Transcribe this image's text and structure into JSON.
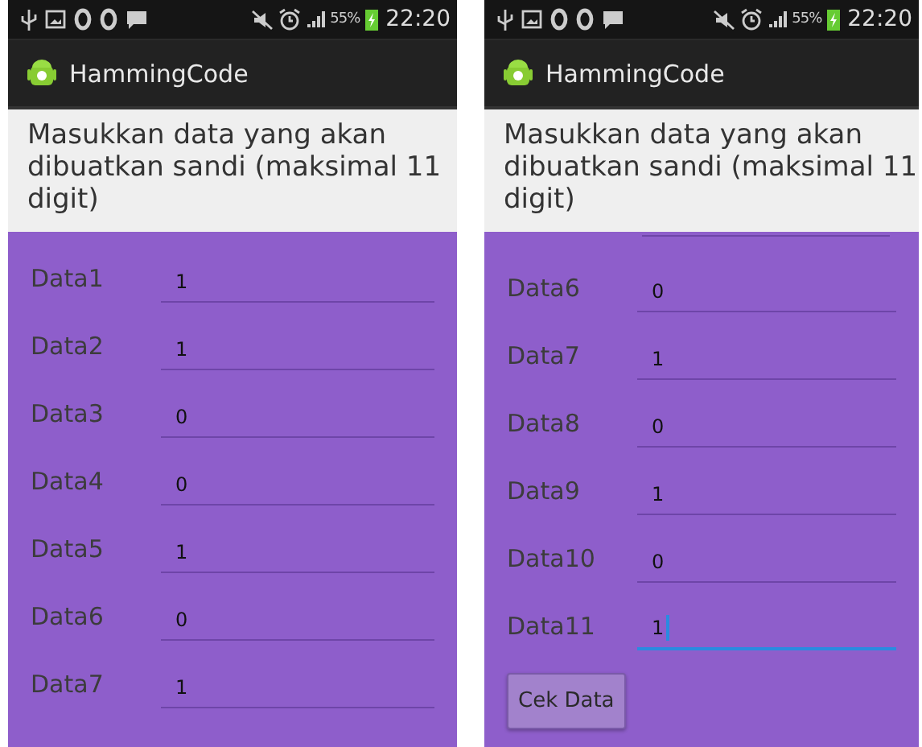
{
  "screens": [
    {
      "status_bar": {
        "battery_text": "55%",
        "time": "22:20"
      },
      "app_title": "HammingCode",
      "prompt": "Masukkan data yang akan dibuatkan sandi (maksimal 11 digit)",
      "rows": [
        {
          "label": "Data1",
          "value": "1",
          "focused": false
        },
        {
          "label": "Data2",
          "value": "1",
          "focused": false
        },
        {
          "label": "Data3",
          "value": "0",
          "focused": false
        },
        {
          "label": "Data4",
          "value": "0",
          "focused": false
        },
        {
          "label": "Data5",
          "value": "1",
          "focused": false
        },
        {
          "label": "Data6",
          "value": "0",
          "focused": false
        },
        {
          "label": "Data7",
          "value": "1",
          "focused": false
        }
      ]
    },
    {
      "status_bar": {
        "battery_text": "55%",
        "time": "22:20"
      },
      "app_title": "HammingCode",
      "prompt": "Masukkan data yang akan dibuatkan sandi (maksimal 11 digit)",
      "scrolled": true,
      "rows": [
        {
          "label": "Data6",
          "value": "0",
          "focused": false
        },
        {
          "label": "Data7",
          "value": "1",
          "focused": false
        },
        {
          "label": "Data8",
          "value": "0",
          "focused": false
        },
        {
          "label": "Data9",
          "value": "1",
          "focused": false
        },
        {
          "label": "Data10",
          "value": "0",
          "focused": false
        },
        {
          "label": "Data11",
          "value": "1",
          "focused": true
        }
      ],
      "button": "Cek Data"
    }
  ]
}
